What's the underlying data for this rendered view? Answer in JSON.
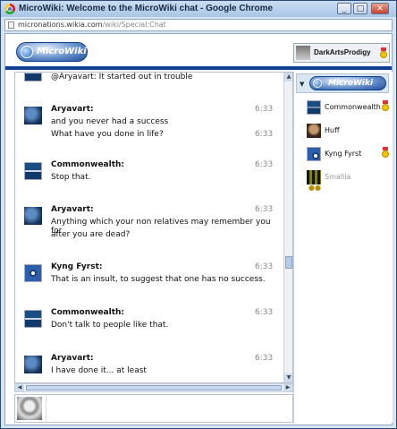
{
  "window": {
    "title": "MicroWiki: Welcome to the MicroWiki chat - Google Chrome",
    "minimize": "_",
    "maximize": "□",
    "close": "✕"
  },
  "address_bar": {
    "host": "micronations.wikia.com",
    "path": "/wiki/Special:Chat"
  },
  "header": {
    "logo_text": "MicroWiki",
    "current_user": "DarkArtsProdigy"
  },
  "messages": [
    {
      "name": "",
      "lines": [
        "@Aryavart: It started out in trouble"
      ],
      "time": ""
    },
    {
      "name": "Aryavart:",
      "lines": [
        "and you never had a success",
        "What have you done in life?"
      ],
      "time": "6:33",
      "time2": "6:33"
    },
    {
      "name": "Commonwealth:",
      "lines": [
        "Stop that."
      ],
      "time": "6:33"
    },
    {
      "name": "Aryavart:",
      "lines": [
        "Anything which your non relatives may remember you for",
        "after you are dead?"
      ],
      "time": "6:33"
    },
    {
      "name": "Kyng Fyrst:",
      "lines": [
        "That is an insult, to suggest that one has no success."
      ],
      "time": "6:33"
    },
    {
      "name": "Commonwealth:",
      "lines": [
        "Don't talk to people like that."
      ],
      "time": "6:33"
    },
    {
      "name": "Aryavart:",
      "lines": [
        "I have done it... at least"
      ],
      "time": "6:33"
    }
  ],
  "sidebar": {
    "room_label": "MicroWiki",
    "users": [
      {
        "name": "Commonwealth",
        "badge": true,
        "away": false
      },
      {
        "name": "Huff",
        "badge": false,
        "away": false
      },
      {
        "name": "Kyng Fyrst",
        "badge": true,
        "away": false
      },
      {
        "name": "Smallia",
        "badge": false,
        "away": true
      }
    ]
  },
  "composer": {
    "value": ""
  }
}
